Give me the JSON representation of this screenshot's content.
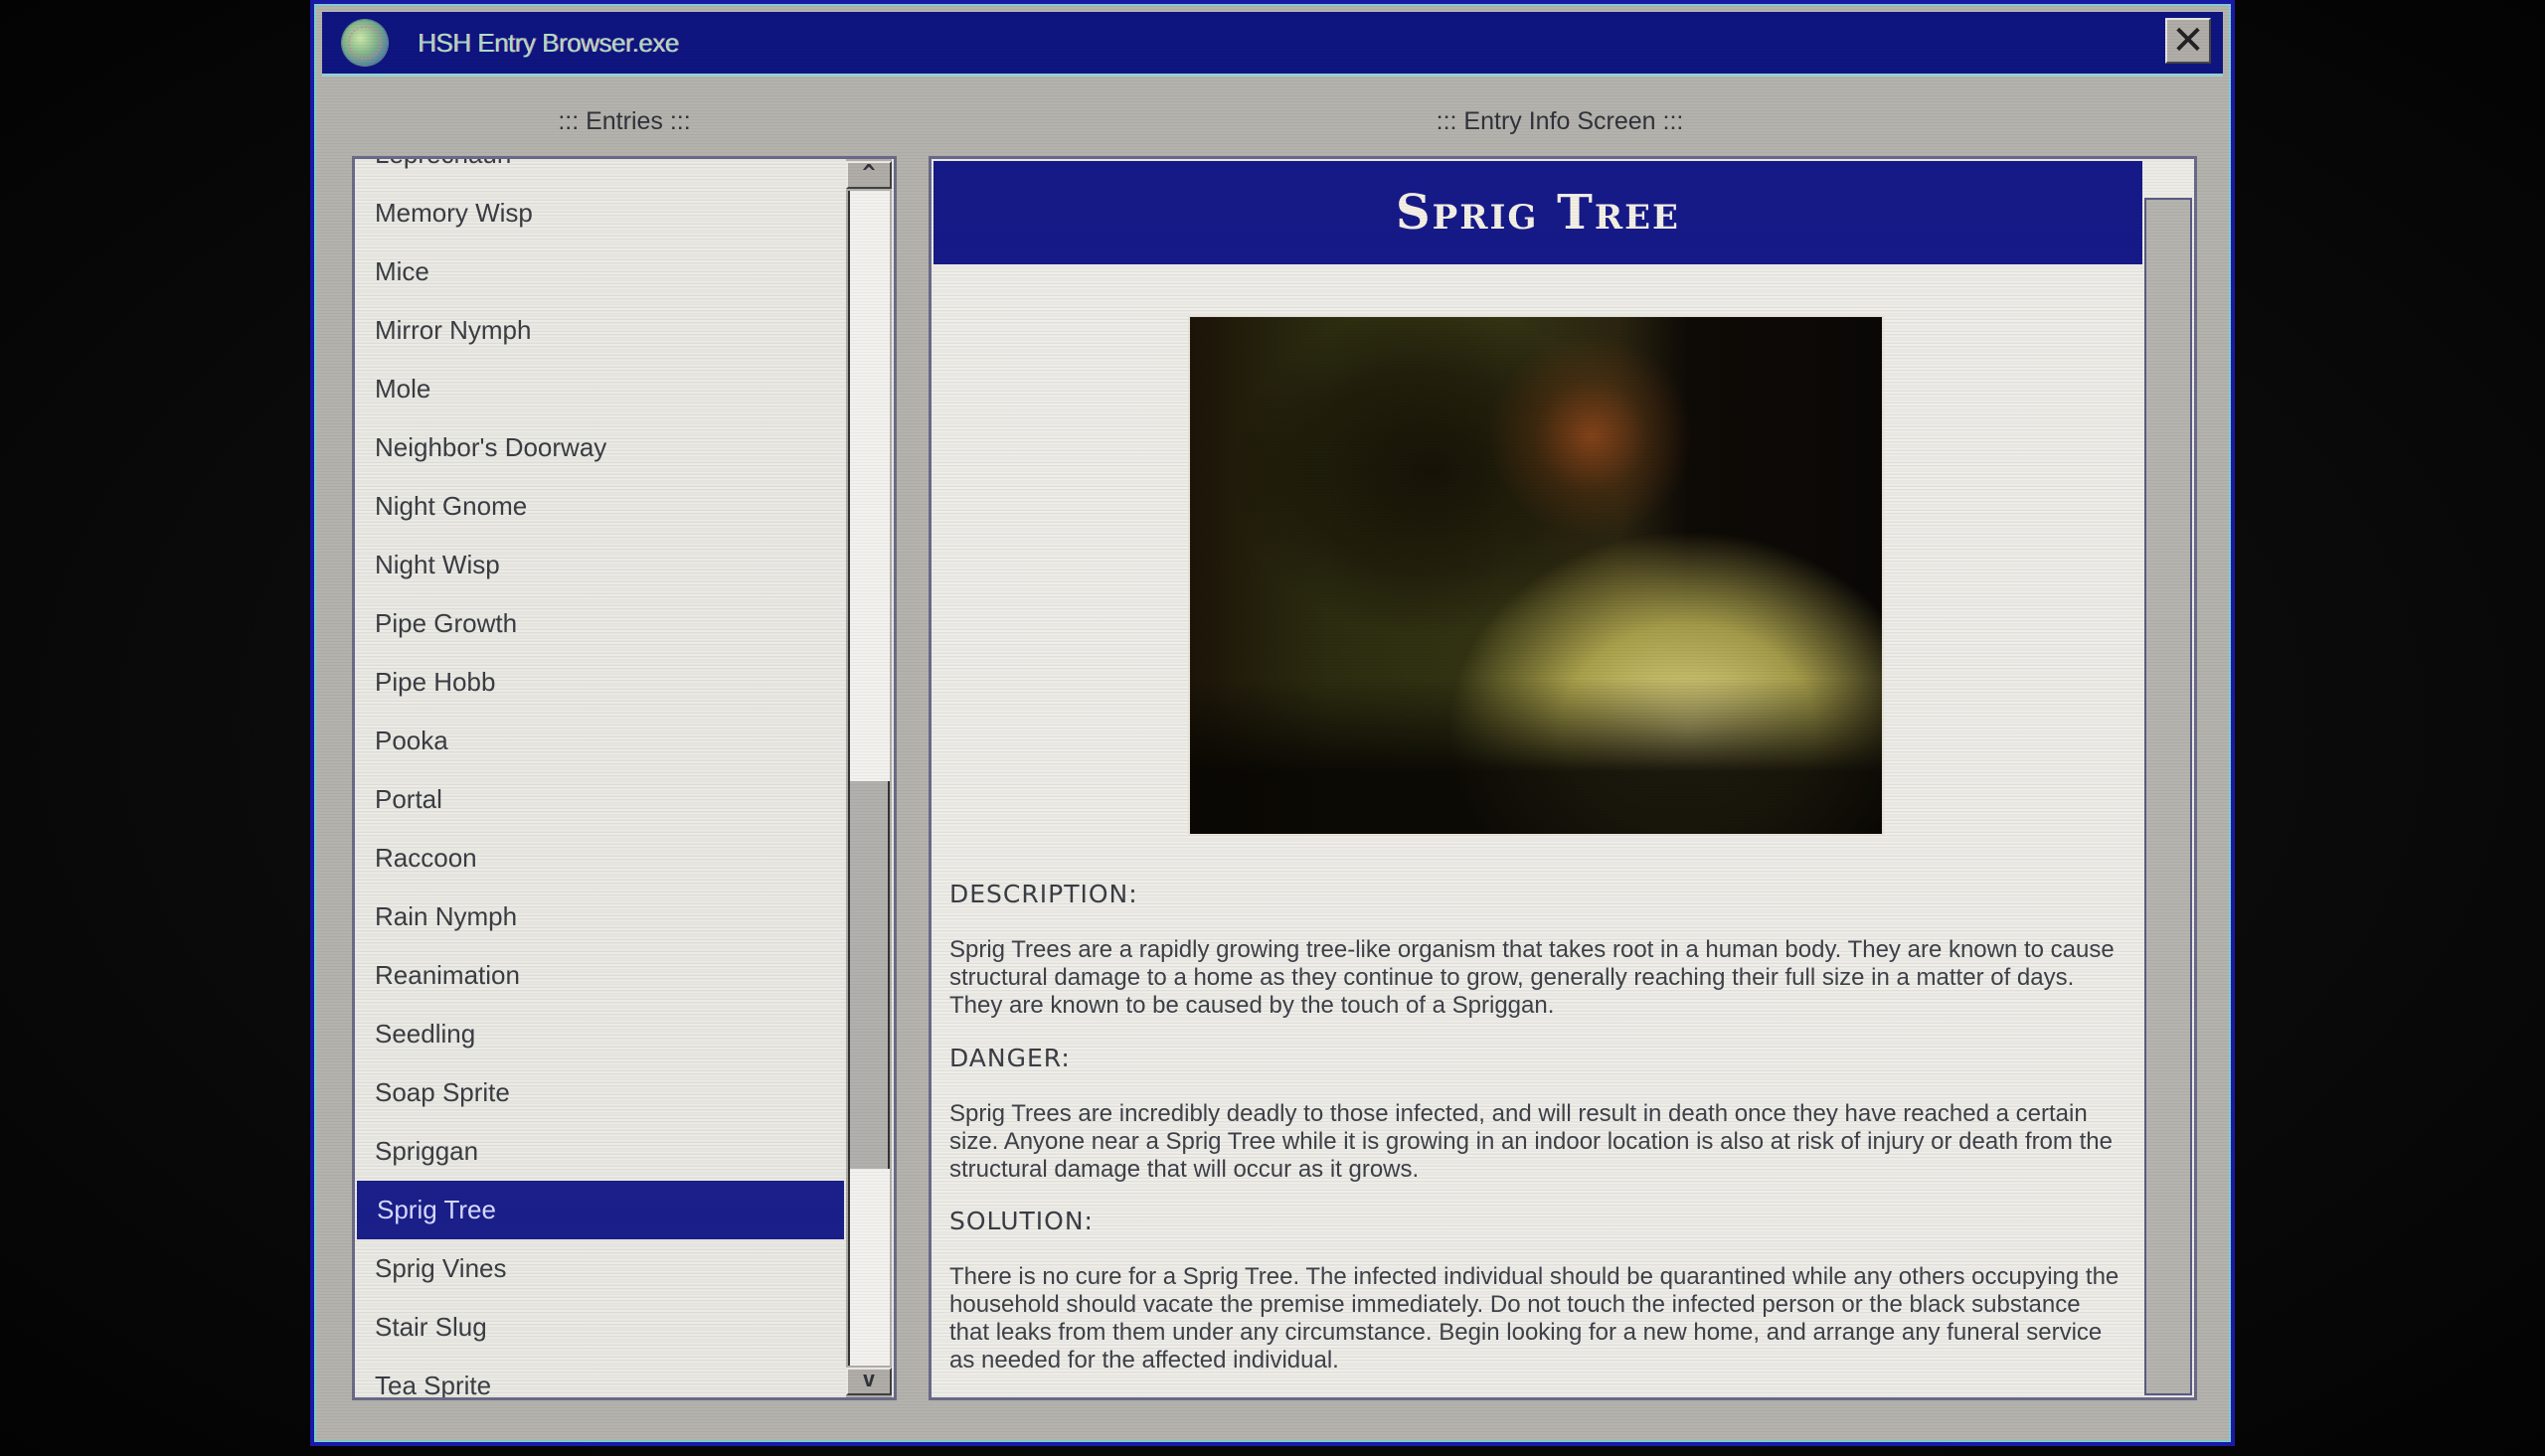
{
  "window": {
    "title": "HSH Entry Browser.exe",
    "icon": "globe-icon",
    "close_glyph": "✕"
  },
  "entries_panel": {
    "label": "::: Entries :::",
    "scroll_up_glyph": "^",
    "scroll_down_glyph": "v",
    "scroll_position": 0.75,
    "visible_fraction": 0.33,
    "items": [
      {
        "label": "Leprechaun",
        "selected": false
      },
      {
        "label": "Memory Wisp",
        "selected": false
      },
      {
        "label": "Mice",
        "selected": false
      },
      {
        "label": "Mirror Nymph",
        "selected": false
      },
      {
        "label": "Mole",
        "selected": false
      },
      {
        "label": "Neighbor's Doorway",
        "selected": false
      },
      {
        "label": "Night Gnome",
        "selected": false
      },
      {
        "label": "Night Wisp",
        "selected": false
      },
      {
        "label": "Pipe Growth",
        "selected": false
      },
      {
        "label": "Pipe Hobb",
        "selected": false
      },
      {
        "label": "Pooka",
        "selected": false
      },
      {
        "label": "Portal",
        "selected": false
      },
      {
        "label": "Raccoon",
        "selected": false
      },
      {
        "label": "Rain Nymph",
        "selected": false
      },
      {
        "label": "Reanimation",
        "selected": false
      },
      {
        "label": "Seedling",
        "selected": false
      },
      {
        "label": "Soap Sprite",
        "selected": false
      },
      {
        "label": "Spriggan",
        "selected": false
      },
      {
        "label": "Sprig Tree",
        "selected": true
      },
      {
        "label": "Sprig Vines",
        "selected": false
      },
      {
        "label": "Stair Slug",
        "selected": false
      },
      {
        "label": "Tea Sprite",
        "selected": false
      }
    ]
  },
  "info_panel": {
    "label": "::: Entry Info Screen :::",
    "title": "Sprig Tree",
    "image_alt": "Dim bedroom with a dark tree-like growth, a floor lamp, and a lit bed",
    "scroll_position": 1.0,
    "visible_fraction": 0.97,
    "sections": [
      {
        "heading": "DESCRIPTION:",
        "body": "Sprig Trees are a rapidly growing tree-like organism that takes root in a human body. They are known to cause structural damage to a home as they continue to grow, generally reaching their full size in a matter of days. They are known to be caused by the touch of a Spriggan."
      },
      {
        "heading": "DANGER:",
        "body": "Sprig Trees are incredibly deadly to those infected, and will result in death once they have reached a certain size. Anyone near a Sprig Tree while it is growing in an indoor location is also at risk of injury or death from the structural damage that will occur as it grows."
      },
      {
        "heading": "SOLUTION:",
        "body": "There is no cure for a Sprig Tree. The infected individual should be quarantined while any others occupying the household should vacate the premise immediately. Do not touch the infected person or the black substance that leaks from them under any circumstance. Begin looking for a new home, and arrange any funeral service as needed for the affected individual."
      }
    ]
  },
  "colors": {
    "titlebar": "#0f1580",
    "selection": "#1b1f8a",
    "window_face": "#b4b2ad",
    "panel_bg": "#efeee9"
  }
}
